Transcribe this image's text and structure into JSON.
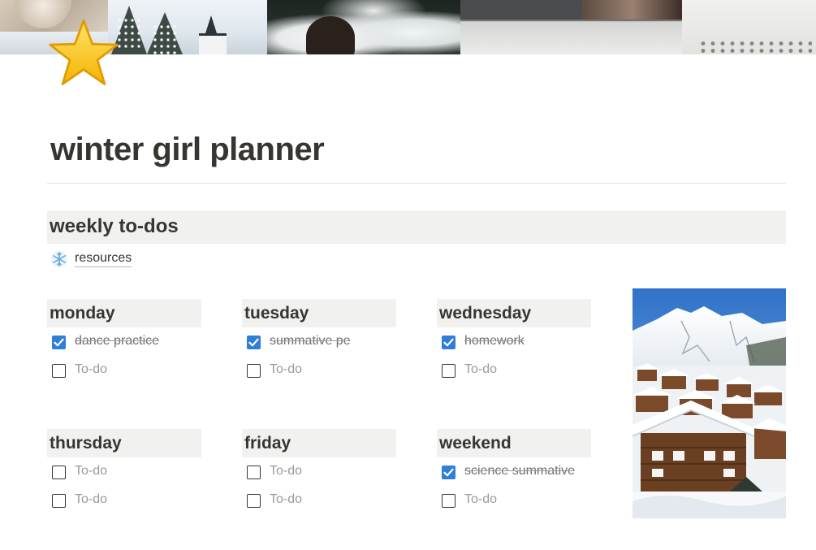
{
  "page": {
    "title": "winter girl planner",
    "icon": "star-icon"
  },
  "section": {
    "heading": "weekly to-dos"
  },
  "resources": {
    "icon": "snowflake-icon",
    "label": "resources"
  },
  "days": [
    {
      "name": "monday",
      "todos": [
        {
          "label": "dance practice",
          "checked": true
        },
        {
          "label": "To-do",
          "checked": false,
          "placeholder": true
        }
      ]
    },
    {
      "name": "tuesday",
      "todos": [
        {
          "label": "summative pe",
          "checked": true
        },
        {
          "label": "To-do",
          "checked": false,
          "placeholder": true
        }
      ]
    },
    {
      "name": "wednesday",
      "todos": [
        {
          "label": "homework",
          "checked": true
        },
        {
          "label": "To-do",
          "checked": false,
          "placeholder": true
        }
      ]
    },
    {
      "name": "thursday",
      "todos": [
        {
          "label": "To-do",
          "checked": false,
          "placeholder": true
        },
        {
          "label": "To-do",
          "checked": false,
          "placeholder": true
        }
      ]
    },
    {
      "name": "friday",
      "todos": [
        {
          "label": "To-do",
          "checked": false,
          "placeholder": true
        },
        {
          "label": "To-do",
          "checked": false,
          "placeholder": true
        }
      ]
    },
    {
      "name": "weekend",
      "todos": [
        {
          "label": "science summative",
          "checked": true
        },
        {
          "label": "To-do",
          "checked": false,
          "placeholder": true
        }
      ]
    }
  ],
  "colors": {
    "checkbox_checked": "#2f7fd8",
    "heading_background": "#f1f1ef",
    "text": "#37352f",
    "placeholder_text": "#9b9a97"
  }
}
